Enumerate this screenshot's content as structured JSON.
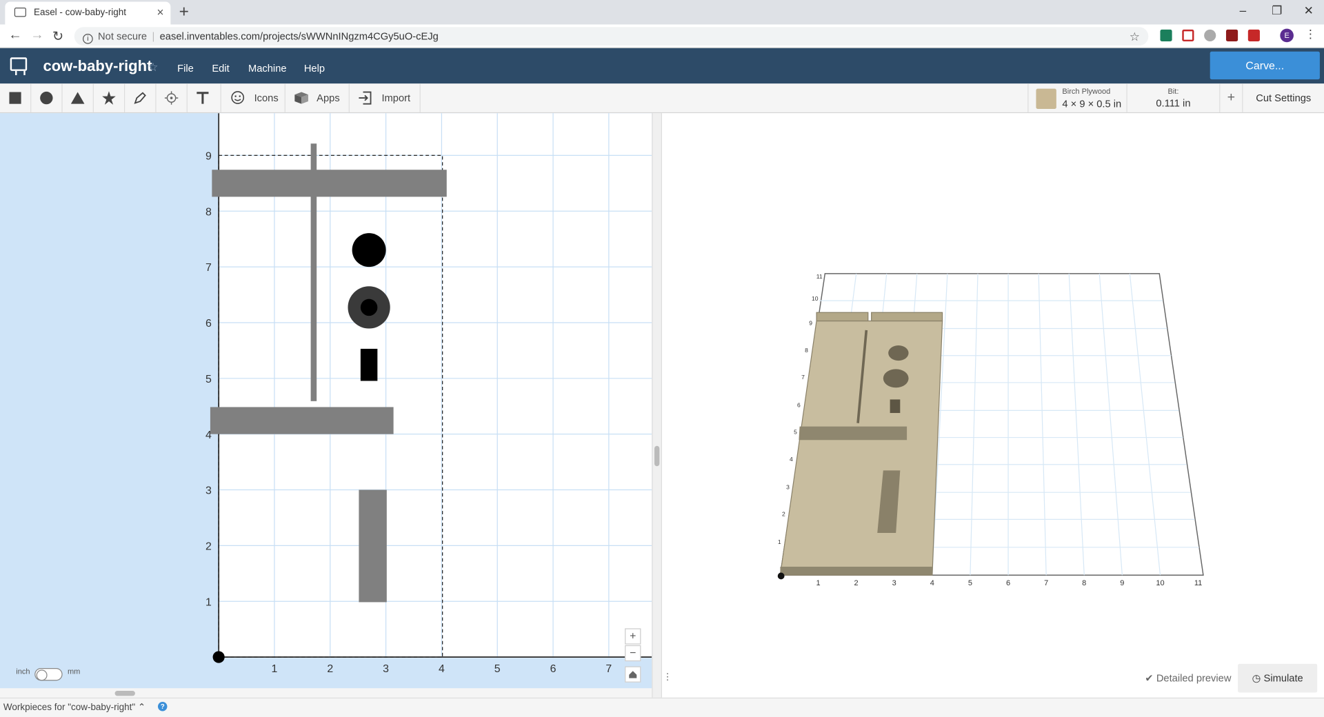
{
  "browser": {
    "tab_title": "Easel - cow-baby-right",
    "new_tab": "+",
    "not_secure": "Not secure",
    "url": "easel.inventables.com/projects/sWWNnINgzm4CGy5uO-cEJg",
    "profile_initial": "E",
    "window_controls": [
      "–",
      "❐",
      "✕"
    ]
  },
  "app": {
    "project_name": "cow-baby-right",
    "menus": [
      "File",
      "Edit",
      "Machine",
      "Help"
    ],
    "carve_label": "Carve..."
  },
  "toolbar": {
    "icons_label": "Icons",
    "apps_label": "Apps",
    "import_label": "Import",
    "material_name": "Birch Plywood",
    "material_size": "4 × 9 × 0.5 in",
    "bit_label": "Bit:",
    "bit_value": "0.111 in",
    "add_label": "+",
    "cut_settings_label": "Cut Settings"
  },
  "canvas": {
    "x_ticks": [
      "1",
      "2",
      "3",
      "4",
      "5",
      "6",
      "7"
    ],
    "y_ticks": [
      "1",
      "2",
      "3",
      "4",
      "5",
      "6",
      "7",
      "8",
      "9"
    ],
    "zoom_in": "+",
    "zoom_out": "−",
    "units_left": "inch",
    "units_right": "mm"
  },
  "preview": {
    "x_ticks": [
      "1",
      "2",
      "3",
      "4",
      "5",
      "6",
      "7",
      "8",
      "9",
      "10",
      "11"
    ],
    "y_ticks": [
      "1",
      "2",
      "3",
      "4",
      "5",
      "6",
      "7",
      "8",
      "9",
      "10",
      "11"
    ],
    "detailed_preview_label": "Detailed preview",
    "simulate_label": "Simulate"
  },
  "footer": {
    "workpieces_label": "Workpieces for \"cow-baby-right\" ⌃",
    "help": "?"
  },
  "colors": {
    "header_bg": "#2d4b68",
    "carve_button": "#3b8fd8",
    "canvas_outside": "#cfe4f8",
    "shape_gray": "#808080",
    "plywood": "#c9b894"
  }
}
